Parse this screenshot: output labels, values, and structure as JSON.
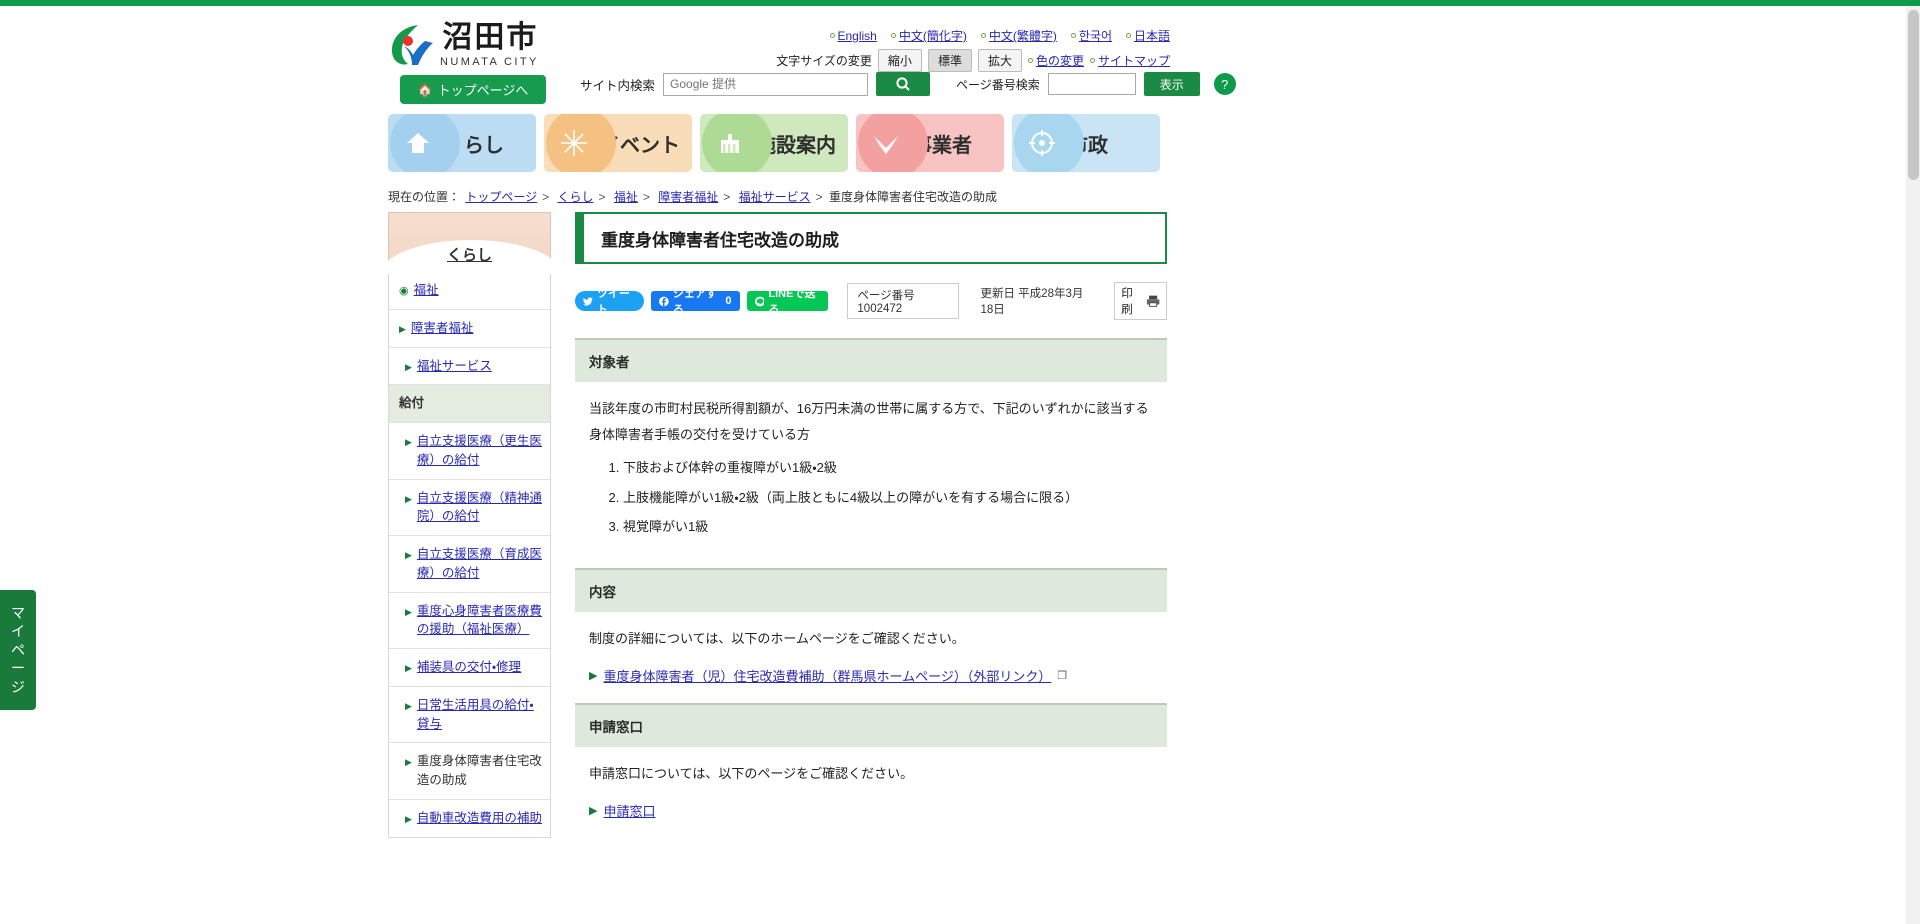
{
  "site": {
    "logo_name": "沼田市",
    "logo_en": "NUMATA CITY",
    "top_button": "トップページへ"
  },
  "languages": [
    {
      "label": "English"
    },
    {
      "label": "中文(簡化字)"
    },
    {
      "label": "中文(繁體字)"
    },
    {
      "label": "한국어"
    },
    {
      "label": "日本語"
    }
  ],
  "textsize": {
    "label": "文字サイズの変更",
    "small": "縮小",
    "normal": "標準",
    "large": "拡大",
    "color_change": "色の変更",
    "sitemap": "サイトマップ"
  },
  "search": {
    "label": "サイト内検索",
    "placeholder": "Google 提供",
    "value": "",
    "page_number_label": "ページ番号検索",
    "page_number_value": "",
    "show_button": "表示",
    "help": "?"
  },
  "gnav": [
    {
      "label": "くらし",
      "icon": "home-icon",
      "color": "#bcdcf3",
      "accent": "#a4d0ef"
    },
    {
      "label": "イベント",
      "icon": "fireworks-icon",
      "color": "#f9dcb8",
      "accent": "#f5c183"
    },
    {
      "label": "施設案内",
      "icon": "building-icon",
      "color": "#cfe8bd",
      "accent": "#aedb94"
    },
    {
      "label": "事業者",
      "icon": "bird-icon",
      "color": "#f7c3c3",
      "accent": "#f3a0a0"
    },
    {
      "label": "市政",
      "icon": "target-icon",
      "color": "#c9e4f5",
      "accent": "#a9d6ef"
    }
  ],
  "breadcrumb": {
    "prefix": "現在の位置：",
    "items": [
      "トップページ",
      "くらし",
      "福祉",
      "障害者福祉",
      "福祉サービス"
    ],
    "current": "重度身体障害者住宅改造の助成"
  },
  "sidebar": {
    "heading": "くらし",
    "items": [
      {
        "label": "福祉",
        "level": "lvl1",
        "marker": "bullet",
        "link": true
      },
      {
        "label": "障害者福祉",
        "level": "lvl1",
        "marker": "tri",
        "link": true
      },
      {
        "label": "福祉サービス",
        "level": "lvl2",
        "marker": "tri",
        "link": true
      },
      {
        "label": "給付",
        "level": "group",
        "marker": "none",
        "link": false
      },
      {
        "label": "自立支援医療（更生医療）の給付",
        "level": "lvl2",
        "marker": "tri",
        "link": true
      },
      {
        "label": "自立支援医療（精神通院）の給付",
        "level": "lvl2",
        "marker": "tri",
        "link": true
      },
      {
        "label": "自立支援医療（育成医療）の給付",
        "level": "lvl2",
        "marker": "tri",
        "link": true
      },
      {
        "label": "重度心身障害者医療費の援助（福祉医療）",
        "level": "lvl2",
        "marker": "tri",
        "link": true
      },
      {
        "label": "補装具の交付・修理",
        "level": "lvl2",
        "marker": "tri",
        "link": true
      },
      {
        "label": "日常生活用具の給付・貸与",
        "level": "lvl2",
        "marker": "tri",
        "link": true
      },
      {
        "label": "重度身体障害者住宅改造の助成",
        "level": "lvl2",
        "marker": "tri",
        "link": false,
        "current": true
      },
      {
        "label": "自動車改造費用の補助",
        "level": "lvl2",
        "marker": "tri",
        "link": true
      }
    ]
  },
  "page": {
    "title": "重度身体障害者住宅改造の助成",
    "share": {
      "tweet": "ツイート",
      "facebook": "シェアする",
      "facebook_count": "0",
      "line": "LINEで送る"
    },
    "page_number": "ページ番号1002472",
    "updated_label": "更新日",
    "updated_value": "平成28年3月18日",
    "print": "印刷"
  },
  "sections": [
    {
      "heading": "対象者",
      "paragraph": "当該年度の市町村民税所得割額が、16万円未満の世帯に属する方で、下記のいずれかに該当する身体障害者手帳の交付を受けている方",
      "list": [
        "下肢および体幹の重複障がい1級・2級",
        "上肢機能障がい1級・2級（両上肢ともに4級以上の障がいを有する場合に限る）",
        "視覚障がい1級"
      ]
    },
    {
      "heading": "内容",
      "paragraph": "制度の詳細については、以下のホームページをご確認ください。",
      "link": "重度身体障害者（児）住宅改造費補助（群馬県ホームページ）（外部リンク）"
    },
    {
      "heading": "申請窓口",
      "paragraph": "申請窓口については、以下のページをご確認ください。",
      "link": "申請窓口"
    }
  ],
  "mypage": "マイページ"
}
